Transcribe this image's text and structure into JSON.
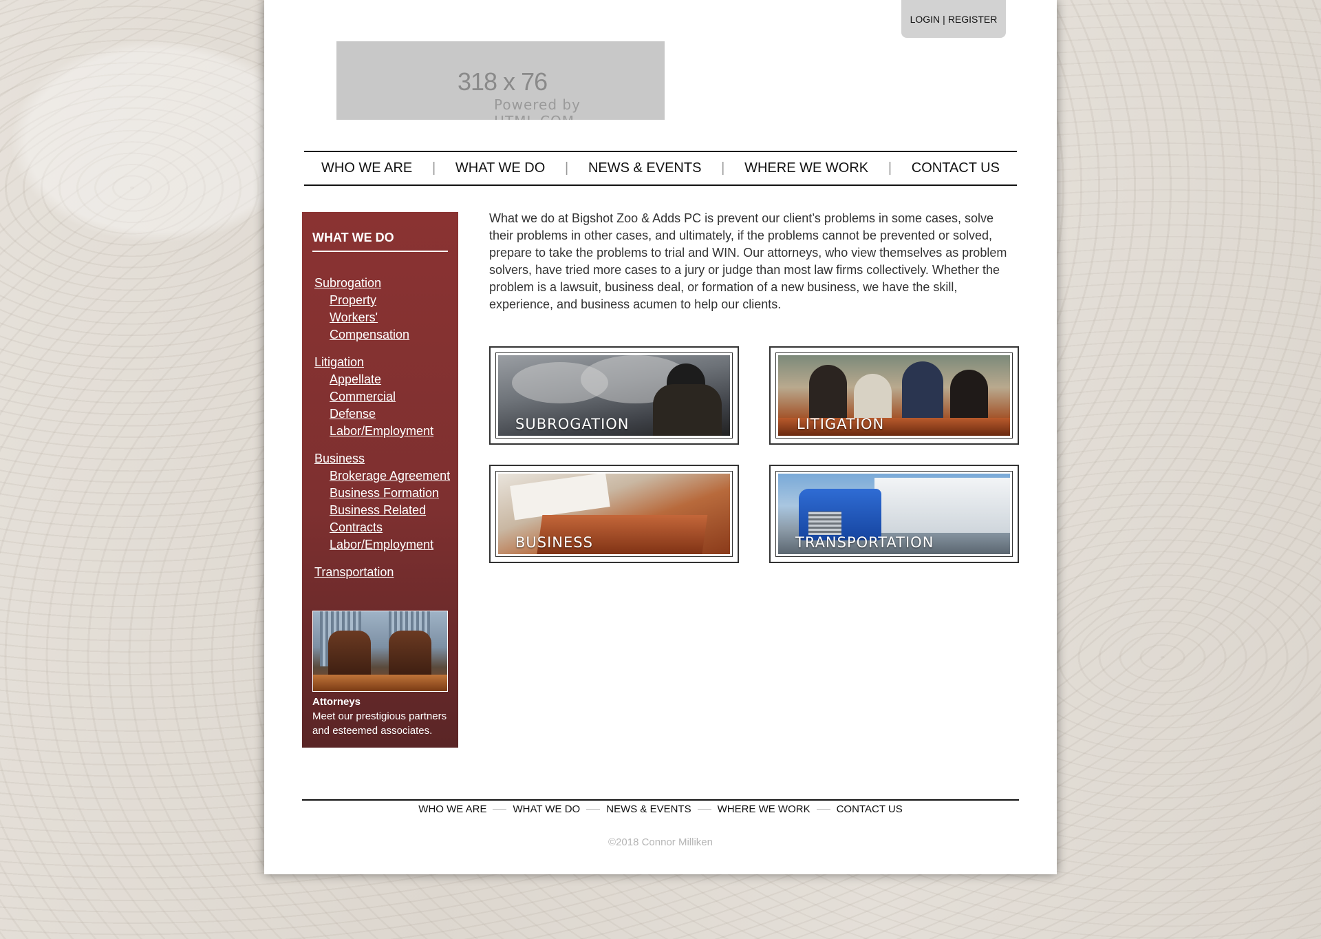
{
  "header": {
    "login_label": "LOGIN",
    "register_label": "REGISTER",
    "auth_separator": "|",
    "logo_dims": "318 x 76",
    "logo_powered": "Powered by HTML.COM"
  },
  "nav": {
    "items": [
      "WHO WE ARE",
      "WHAT WE DO",
      "NEWS & EVENTS",
      "WHERE WE WORK",
      "CONTACT US"
    ],
    "separator": "|"
  },
  "sidebar": {
    "title": "WHAT WE DO",
    "groups": [
      {
        "label": "Subrogation",
        "subs": [
          "Property",
          "Workers' Compensation"
        ]
      },
      {
        "label": "Litigation",
        "subs": [
          "Appellate",
          "Commercial",
          "Defense",
          "Labor/Employment"
        ]
      },
      {
        "label": "Business",
        "subs": [
          "Brokerage Agreement",
          "Business Formation",
          "Business Related Contracts",
          "Labor/Employment"
        ]
      },
      {
        "label": "Transportation",
        "subs": []
      }
    ],
    "attorneys_title": "Attorneys",
    "attorneys_desc": "Meet our prestigious partners and esteemed associates."
  },
  "main": {
    "intro": "What we do at Bigshot Zoo & Adds PC is prevent our client’s problems in some cases, solve their problems in other cases, and ultimately, if the problems cannot be prevented or solved, prepare to take the problems to trial and WIN. Our attorneys, who view themselves as problem solvers, have tried more cases to a jury or judge than most law firms collectively. Whether the problem is a lawsuit, business deal, or formation of a new business, we have the skill, experience, and business acumen to help our clients.",
    "tiles": [
      "SUBROGATION",
      "LITIGATION",
      "BUSINESS",
      "TRANSPORTATION"
    ]
  },
  "footer": {
    "nav": [
      "WHO WE ARE",
      "WHAT WE DO",
      "NEWS & EVENTS",
      "WHERE WE WORK",
      "CONTACT US"
    ],
    "copyright": "©2018 Connor Milliken"
  },
  "colors": {
    "sidebar": "#8a3332",
    "page_bg": "#ffffff",
    "login_tab": "#d2d2d2"
  }
}
